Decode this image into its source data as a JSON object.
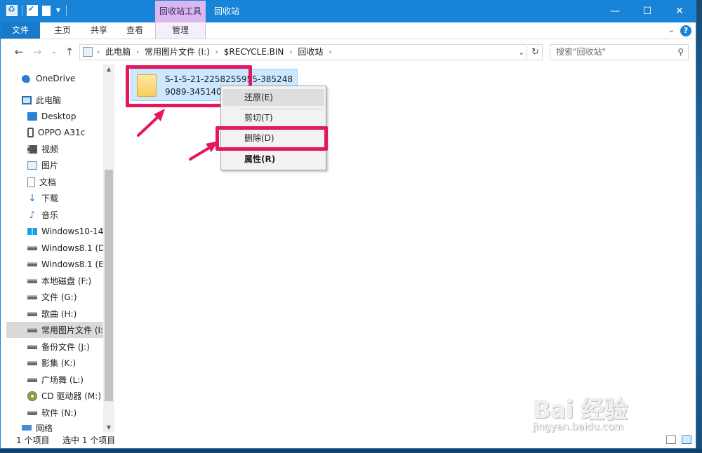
{
  "titlebar": {
    "contextual_tab": "回收站工具",
    "window_title": "回收站",
    "minimize": "—",
    "maximize": "☐",
    "close": "✕"
  },
  "ribbon": {
    "tabs": [
      {
        "label": "文件"
      },
      {
        "label": "主页"
      },
      {
        "label": "共享"
      },
      {
        "label": "查看"
      },
      {
        "label": "管理"
      }
    ],
    "collapse_icon": "chevron-down-icon",
    "help_icon": "help-icon",
    "help_glyph": "?"
  },
  "navigation": {
    "back": "←",
    "forward": "→",
    "recent": "⌄",
    "up": "↑",
    "breadcrumb": [
      "此电脑",
      "常用图片文件 (I:)",
      "$RECYCLE.BIN",
      "回收站"
    ],
    "crumb_separator": "›",
    "dropdown": "⌄",
    "refresh": "↻"
  },
  "search": {
    "placeholder": "搜索\"回收站\"",
    "icon": "⚲"
  },
  "nav_pane": {
    "items": [
      {
        "label": "OneDrive",
        "icon": "onedrive-icon"
      },
      {
        "label": "此电脑",
        "icon": "this-pc-icon"
      },
      {
        "label": "Desktop",
        "icon": "desktop-icon"
      },
      {
        "label": "OPPO A31c",
        "icon": "phone-icon"
      },
      {
        "label": "视频",
        "icon": "video-icon"
      },
      {
        "label": "图片",
        "icon": "pictures-icon"
      },
      {
        "label": "文档",
        "icon": "documents-icon"
      },
      {
        "label": "下载",
        "icon": "download-icon"
      },
      {
        "label": "音乐",
        "icon": "music-icon"
      },
      {
        "label": "Windows10-14",
        "icon": "windows-drive-icon"
      },
      {
        "label": "Windows8.1 (D",
        "icon": "drive-icon"
      },
      {
        "label": "Windows8.1 (E",
        "icon": "drive-icon"
      },
      {
        "label": "本地磁盘 (F:)",
        "icon": "drive-icon"
      },
      {
        "label": "文件 (G:)",
        "icon": "drive-icon"
      },
      {
        "label": "歌曲 (H:)",
        "icon": "drive-icon"
      },
      {
        "label": "常用图片文件 (I:",
        "icon": "drive-icon"
      },
      {
        "label": "备份文件 (J:)",
        "icon": "drive-icon"
      },
      {
        "label": "影集 (K:)",
        "icon": "drive-icon"
      },
      {
        "label": "广场舞 (L:)",
        "icon": "drive-icon"
      },
      {
        "label": "CD 驱动器 (M:)",
        "icon": "cd-drive-icon"
      },
      {
        "label": "软件 (N:)",
        "icon": "drive-icon"
      },
      {
        "label": "网络",
        "icon": "network-icon"
      }
    ],
    "selected_label": "常用图片文件 (I:"
  },
  "file": {
    "name": "S-1-5-21-2258255955-3852489089-345140644"
  },
  "context_menu": {
    "items": [
      {
        "label": "还原(E)"
      },
      {
        "label": "剪切(T)"
      },
      {
        "label": "删除(D)"
      },
      {
        "label": "属性(R)"
      }
    ]
  },
  "statusbar": {
    "item_count": "1 个项目",
    "selected": "选中 1 个项目"
  },
  "watermark": {
    "logo": "Bai 经验",
    "url": "jingyan.baidu.com"
  },
  "colors": {
    "titlebar": "#1883d7",
    "contextual_tab": "#d9b8ee",
    "selection": "#cce8ff",
    "highlight": "#e4185b"
  }
}
